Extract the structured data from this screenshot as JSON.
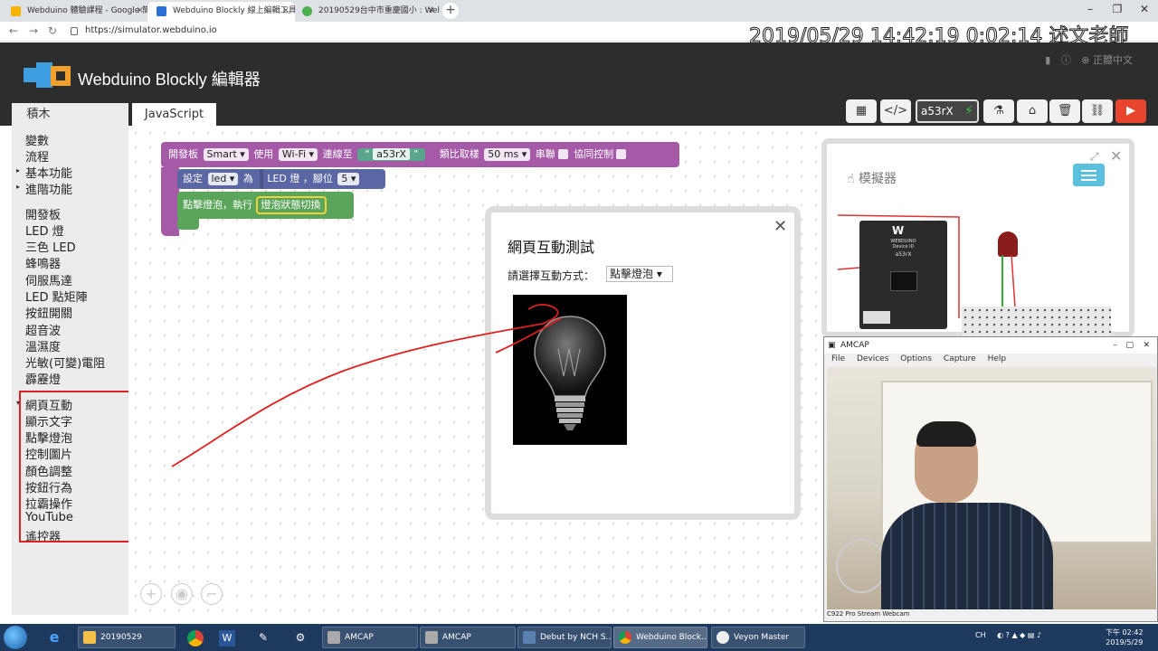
{
  "browser": {
    "tabs": [
      {
        "label": "Webduino 體驗課程 - Google 簡"
      },
      {
        "label": "Webduino Blockly 線上編輯工具"
      },
      {
        "label": "20190529台中市重慶國小 : Wel"
      }
    ],
    "url": "https://simulator.webduino.io",
    "overlay_text": "2019/05/29 14:42:19 0:02:14 述文老師"
  },
  "app": {
    "title": "Webduino Blockly 編輯器",
    "language": "正體中文",
    "tab_blocks": "積木",
    "tab_js": "JavaScript",
    "device_id": "a53rX"
  },
  "toolbox": {
    "items": [
      "變數",
      "流程",
      "基本功能",
      "進階功能",
      "開發板",
      "LED 燈",
      "三色 LED",
      "蜂鳴器",
      "伺服馬達",
      "LED 點矩陣",
      "按鈕開關",
      "超音波",
      "溫濕度",
      "光敏(可變)電阻",
      "霹靂燈"
    ],
    "web_items": [
      "網頁互動",
      "顯示文字",
      "點擊燈泡",
      "控制圖片",
      "顏色調整",
      "按鈕行為",
      "拉霸操作",
      "YouTube",
      "遙控器"
    ]
  },
  "blocks": {
    "board_label": "開發板",
    "board_value": "Smart",
    "use_label": "使用",
    "conn_value": "Wi-Fi",
    "connect_label": "連線至",
    "device_text": "a53rX",
    "sample_label": "類比取樣",
    "sample_value": "50 ms",
    "serial_label": "串聯",
    "coop_label": "協同控制",
    "set_label": "設定",
    "var_value": "led",
    "as_label": "為",
    "led_label": "LED 燈",
    "pin_label": "，腳位",
    "pin_value": "5",
    "click_label": "點擊燈泡，執行",
    "toggle_label": "燈泡狀態切換"
  },
  "dialog": {
    "title": "網頁互動測試",
    "select_label": "請選擇互動方式：",
    "select_value": "點擊燈泡"
  },
  "simulator": {
    "title": "模擬器",
    "board_text": "WEBDUINO",
    "device_label": "Device ID",
    "device_id": "a53rX"
  },
  "amcap": {
    "title": "AMCAP",
    "menu": [
      "File",
      "Devices",
      "Options",
      "Capture",
      "Help"
    ],
    "status": "C922 Pro Stream Webcam"
  },
  "taskbar": {
    "apps": [
      "20190529",
      "AMCAP",
      "AMCAP",
      "Debut by NCH S...",
      "Webduino Block...",
      "Veyon Master"
    ],
    "tray_lang": "CH",
    "time": "下午 02:42",
    "date": "2019/5/29"
  },
  "colors": {
    "header": "#2d2d2d",
    "run_button": "#e8452f",
    "board_block": "#a55aa8",
    "led_block": "#5b67a5",
    "event_block": "#5ba55b",
    "text_block": "#5ba58c",
    "annotation": "#e02020"
  }
}
